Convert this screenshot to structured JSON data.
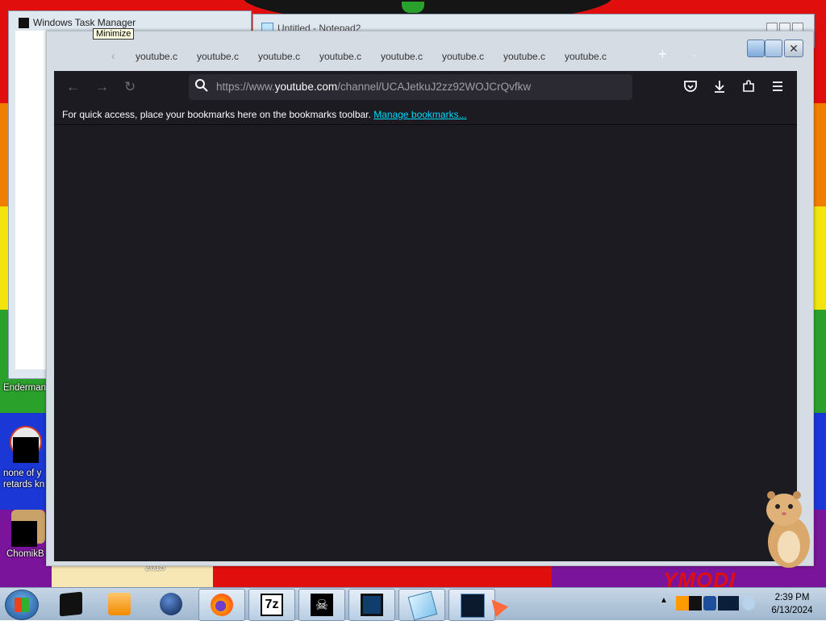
{
  "colors": {
    "firefox_bg": "#1c1b22",
    "urlbar_bg": "#2b2a33",
    "link": "#00ddff"
  },
  "background_windows": {
    "task_manager_title": "Windows Task Manager",
    "notepad_title": "Untitled - Notepad2",
    "tooltip": "Minimize"
  },
  "desktop": {
    "icons": [
      {
        "label_line1": "Enderman"
      },
      {
        "label_line1": "none of y",
        "label_line2": "retards kn"
      },
      {
        "label_line1": "ChomikB"
      }
    ],
    "year_label": "2015",
    "ymobi_text": "YMODI"
  },
  "firefox": {
    "tabs": [
      "youtube.c",
      "youtube.c",
      "youtube.c",
      "youtube.c",
      "youtube.c",
      "youtube.c",
      "youtube.c",
      "youtube.c"
    ],
    "url_prefix": "https://www.",
    "url_host": "youtube.com",
    "url_path": "/channel/UCAJetkuJ2zz92WOJCrQvfkw",
    "bookmarks_text": "For quick access, place your bookmarks here on the bookmarks toolbar.",
    "manage_bookmarks": "Manage bookmarks..."
  },
  "taskbar": {
    "apps": [
      "terminal-icon",
      "media-player-icon",
      "globe-icon",
      "firefox-icon",
      "7zip-icon",
      "pirate-icon",
      "display-icon",
      "notepad-icon",
      "task-manager-icon"
    ],
    "zip_label": "7z",
    "time": "2:39 PM",
    "date": "6/13/2024"
  }
}
